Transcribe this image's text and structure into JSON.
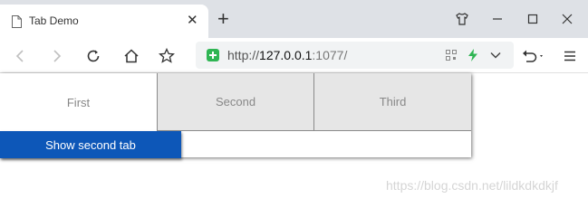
{
  "browser": {
    "tab": {
      "title": "Tab Demo",
      "icon": "document-icon"
    },
    "new_tab_label": "+",
    "url": {
      "scheme": "http://",
      "host": "127.0.0.1",
      "rest": ":1077/"
    }
  },
  "page": {
    "tabs": [
      {
        "label": "First"
      },
      {
        "label": "Second"
      },
      {
        "label": "Third"
      }
    ],
    "show_button_label": "Show second tab"
  },
  "watermark": "https://blog.csdn.net/lildkdkdkjf",
  "colors": {
    "button_blue": "#0d57b8",
    "inactive_tab_bg": "#e6e6e6",
    "titlebar_bg": "#dee1e6",
    "shield_green": "#2fb553"
  }
}
